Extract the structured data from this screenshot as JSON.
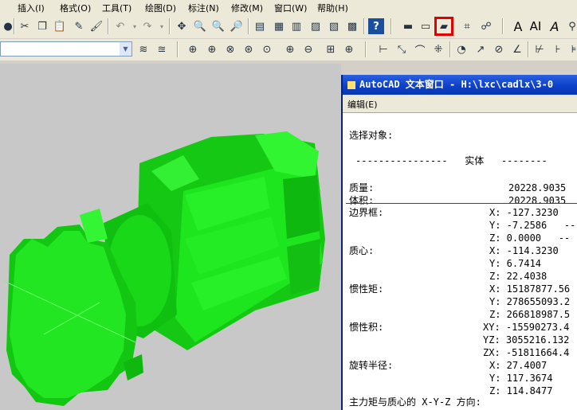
{
  "menubar": {
    "items": [
      "插入(I)",
      "格式(O)",
      "工具(T)",
      "绘图(D)",
      "标注(N)",
      "修改(M)",
      "窗口(W)",
      "帮助(H)"
    ]
  },
  "toolbar": {
    "icons": [
      "undo-icon",
      "redo-icon",
      "cut-icon",
      "copy-icon",
      "paste-icon",
      "match-properties-icon",
      "pan-icon",
      "zoom-realtime-icon",
      "zoom-window-icon",
      "zoom-previous-icon",
      "design-center-icon",
      "properties-icon",
      "tool-palettes-icon",
      "sheet-set-icon",
      "calculator-icon",
      "help-icon",
      "text-style-icon",
      "dimension-style-icon",
      "mass-properties-icon",
      "table-style-icon",
      "multiline-text-icon"
    ],
    "text_labels": [
      "A",
      "AI",
      "A"
    ],
    "highlight_color": "#e00000"
  },
  "textwin": {
    "title": "AutoCAD 文本窗口 - H:\\lxc\\cadlx\\3-0",
    "menu_edit": "编辑(E)",
    "lines": {
      "select_objects": "选择对象:",
      "solid_header": "----------------   实体   --------",
      "mass_label": "质量:",
      "mass_value": "20228.9035",
      "volume_label": "体积:",
      "volume_value": "20228.9035",
      "bbox_label": "边界框:",
      "bbox_x": "X: -127.3230",
      "bbox_y": "Y: -7.2586   --",
      "bbox_z": "Z: 0.0000   --",
      "centroid_label": "质心:",
      "centroid_x": "X: -114.3230",
      "centroid_y": "Y: 6.7414",
      "centroid_z": "Z: 22.4038",
      "moi_label": "惯性矩:",
      "moi_x": "X: 15187877.56",
      "moi_y": "Y: 278655093.2",
      "moi_z": "Z: 266818987.5",
      "poi_label": "惯性积:",
      "poi_xy": "XY: -15590273.4",
      "poi_yz": "YZ: 3055216.132",
      "poi_zx": "ZX: -51811664.4",
      "rog_label": "旋转半径:",
      "rog_x": "X: 27.4007",
      "rog_y": "Y: 117.3674",
      "rog_z": "Z: 114.8477",
      "principal": "主力矩与质心的 X-Y-Z 方向:"
    }
  },
  "colors": {
    "solid_green": "#22e622",
    "background": "#c8c8c8",
    "title_blue": "#0c3fc7"
  }
}
